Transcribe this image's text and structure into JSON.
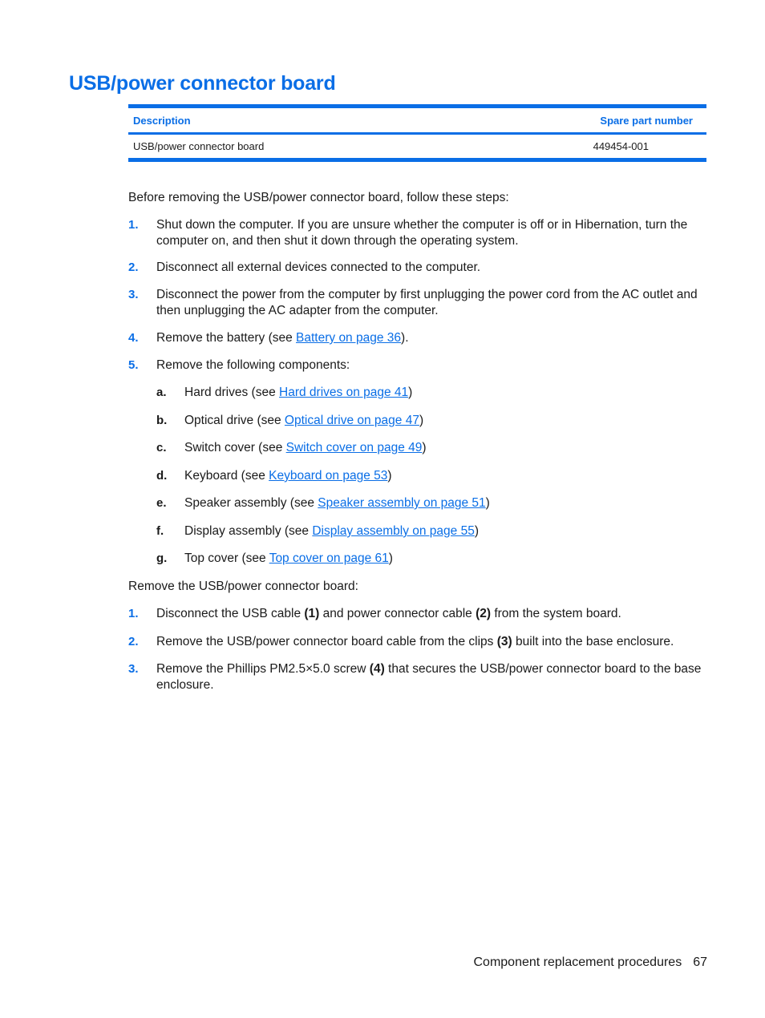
{
  "title": "USB/power connector board",
  "table": {
    "headers": [
      "Description",
      "Spare part number"
    ],
    "rows": [
      {
        "description": "USB/power connector board",
        "spare_part_number": "449454-001"
      }
    ]
  },
  "intro": "Before removing the USB/power connector board, follow these steps:",
  "prep_steps": [
    {
      "num": "1.",
      "text": "Shut down the computer. If you are unsure whether the computer is off or in Hibernation, turn the computer on, and then shut it down through the operating system."
    },
    {
      "num": "2.",
      "text": "Disconnect all external devices connected to the computer."
    },
    {
      "num": "3.",
      "text": "Disconnect the power from the computer by first unplugging the power cord from the AC outlet and then unplugging the AC adapter from the computer."
    },
    {
      "num": "4.",
      "pre": "Remove the battery (see ",
      "link": "Battery on page 36",
      "post": ")."
    },
    {
      "num": "5.",
      "text": "Remove the following components:"
    }
  ],
  "components": [
    {
      "letter": "a.",
      "pre": "Hard drives (see ",
      "link": "Hard drives on page 41",
      "post": ")"
    },
    {
      "letter": "b.",
      "pre": "Optical drive (see ",
      "link": "Optical drive on page 47",
      "post": ")"
    },
    {
      "letter": "c.",
      "pre": "Switch cover (see ",
      "link": "Switch cover on page 49",
      "post": ")"
    },
    {
      "letter": "d.",
      "pre": "Keyboard (see ",
      "link": "Keyboard on page 53",
      "post": ")"
    },
    {
      "letter": "e.",
      "pre": "Speaker assembly (see ",
      "link": "Speaker assembly on page 51",
      "post": ")"
    },
    {
      "letter": "f.",
      "pre": "Display assembly (see ",
      "link": "Display assembly on page 55",
      "post": ")"
    },
    {
      "letter": "g.",
      "pre": "Top cover (see ",
      "link": "Top cover on page 61",
      "post": ")"
    }
  ],
  "remove_intro": "Remove the USB/power connector board:",
  "remove_steps": [
    {
      "num": "1.",
      "parts": [
        "Disconnect the USB cable ",
        "(1)",
        " and power connector cable ",
        "(2)",
        " from the system board."
      ]
    },
    {
      "num": "2.",
      "parts": [
        "Remove the USB/power connector board cable from the clips ",
        "(3)",
        " built into the base enclosure."
      ]
    },
    {
      "num": "3.",
      "parts": [
        "Remove the Phillips PM2.5×5.0 screw ",
        "(4)",
        " that secures the USB/power connector board to the base enclosure."
      ]
    }
  ],
  "footer": {
    "section": "Component replacement procedures",
    "page": "67"
  },
  "colors": {
    "accent": "#0a6ee6",
    "text": "#1a1a1a"
  }
}
